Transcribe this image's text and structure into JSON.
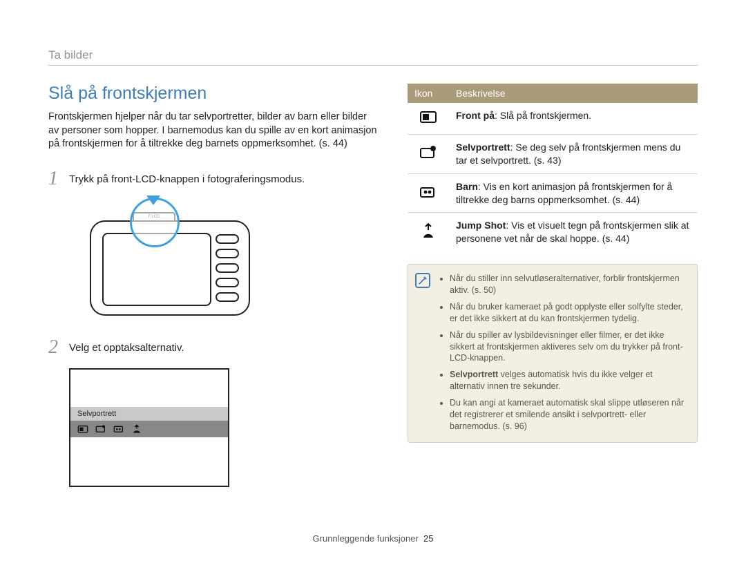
{
  "breadcrumb": "Ta bilder",
  "section_title": "Slå på frontskjermen",
  "intro": "Frontskjermen hjelper når du tar selvportretter, bilder av barn eller bilder av personer som hopper. I barnemodus kan du spille av en kort animasjon på frontskjermen for å tiltrekke deg barnets oppmerksomhet. (s. 44)",
  "steps": {
    "s1_num": "1",
    "s1_text": "Trykk på front-LCD-knappen i fotograferingsmodus.",
    "s2_num": "2",
    "s2_text": "Velg et opptaksalternativ."
  },
  "camera_button_label": "F.LCD",
  "option_label": "Selvportrett",
  "table": {
    "h1": "Ikon",
    "h2": "Beskrivelse",
    "rows": [
      {
        "icon": "front-on-icon",
        "bold": "Front på",
        "rest": ": Slå på frontskjermen."
      },
      {
        "icon": "selfie-icon",
        "bold": "Selvportrett",
        "rest": ": Se deg selv på frontskjermen mens du tar et selvportrett. (s. 43)"
      },
      {
        "icon": "children-icon",
        "bold": "Barn",
        "rest": ": Vis en kort animasjon på frontskjermen for å tiltrekke deg barns oppmerksomhet. (s. 44)"
      },
      {
        "icon": "jumpshot-icon",
        "bold": "Jump Shot",
        "rest": ": Vis et visuelt tegn på frontskjermen slik at personene vet når de skal hoppe. (s. 44)"
      }
    ]
  },
  "notes": [
    "Når du stiller inn selvutløseralternativer, forblir frontskjermen aktiv. (s. 50)",
    "Når du bruker kameraet på godt opplyste eller solfylte steder, er det ikke sikkert at du kan frontskjermen tydelig.",
    "Når du spiller av lysbildevisninger eller filmer, er det ikke sikkert at frontskjermen aktiveres selv om du trykker på front-LCD-knappen.",
    "",
    "Du kan angi at kameraet automatisk skal slippe utløseren når det registrerer et smilende ansikt i selvportrett- eller barnemodus. (s. 96)"
  ],
  "note4_bold": "Selvportrett",
  "note4_rest": " velges automatisk hvis du ikke velger et alternativ innen tre sekunder.",
  "footer_label": "Grunnleggende funksjoner",
  "footer_page": "25"
}
